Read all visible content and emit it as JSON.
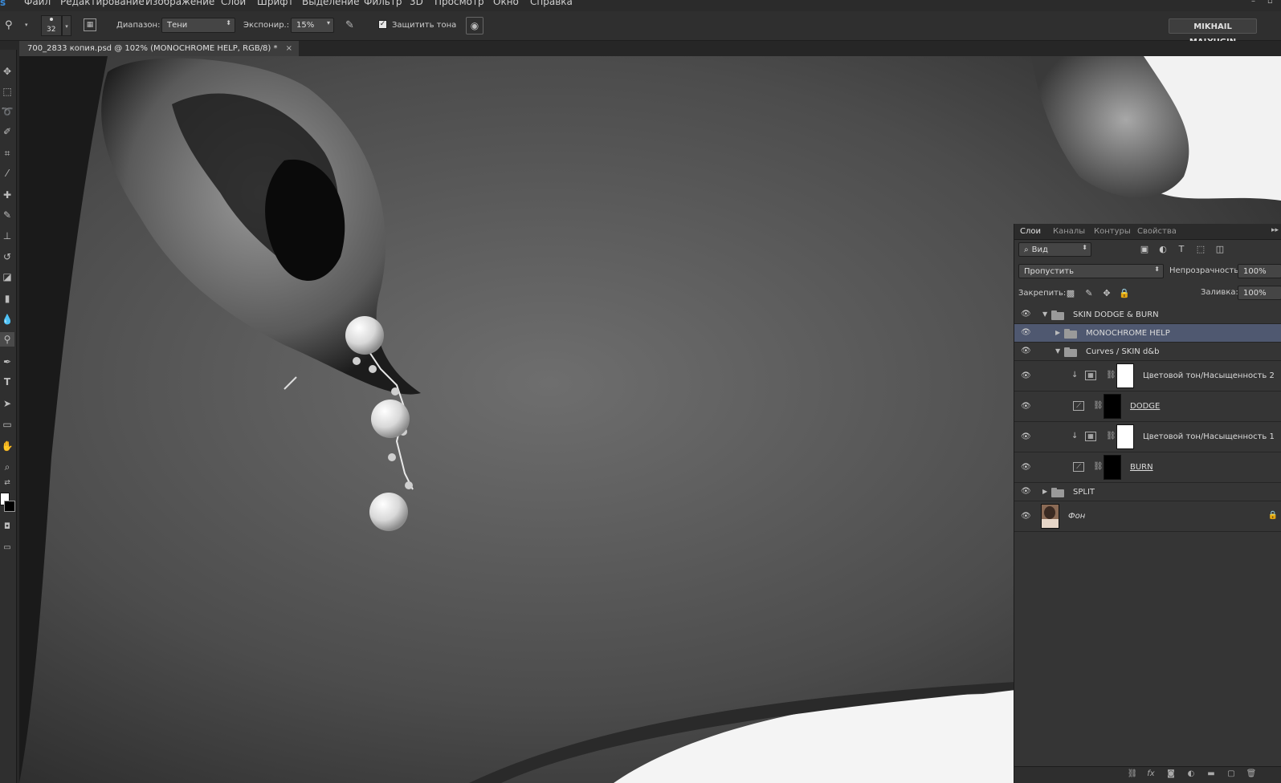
{
  "menu": {
    "logo": "s",
    "items": [
      "Файл",
      "Редактирование",
      "Изображение",
      "Слои",
      "Шрифт",
      "Выделение",
      "Фильтр",
      "3D",
      "Просмотр",
      "Окно",
      "Справка"
    ]
  },
  "options": {
    "brush_size": "32",
    "range_label": "Диапазон:",
    "range_value": "Тени",
    "exposure_label": "Экспонир.:",
    "exposure_value": "15%",
    "protect_label": "Защитить тона",
    "protect_checked": true,
    "user": "MIKHAIL MALYUGIN"
  },
  "document_tab": {
    "title": "700_2833 копия.psd @ 102% (MONOCHROME HELP, RGB/8) *",
    "close": "×"
  },
  "layers_panel": {
    "tabs": [
      "Слои",
      "Каналы",
      "Контуры",
      "Свойства"
    ],
    "active_tab": "Слои",
    "filter_value": "Вид",
    "blend_mode": "Пропустить",
    "opacity_label": "Непрозрачность:",
    "opacity_value": "100%",
    "lock_label": "Закрепить:",
    "fill_label": "Заливка:",
    "fill_value": "100%",
    "layers": [
      {
        "name": "SKIN DODGE & BURN",
        "type": "group",
        "expanded": true
      },
      {
        "name": "MONOCHROME HELP",
        "type": "group",
        "expanded": false,
        "selected": true
      },
      {
        "name": "Curves  / SKIN d&b",
        "type": "group",
        "expanded": true
      },
      {
        "name": "Цветовой тон/Насыщенность 2",
        "type": "adjustment",
        "mask": "white",
        "clipped": true
      },
      {
        "name": "DODGE",
        "type": "curves",
        "mask": "black"
      },
      {
        "name": "Цветовой тон/Насыщенность 1",
        "type": "adjustment",
        "mask": "white",
        "clipped": true
      },
      {
        "name": "BURN",
        "type": "curves",
        "mask": "black"
      },
      {
        "name": "SPLIT",
        "type": "group",
        "expanded": false
      },
      {
        "name": "Фон",
        "type": "background",
        "locked": true
      }
    ]
  },
  "colors": {
    "selected_layer": "#4f5870",
    "panel_bg": "#353535",
    "accent_blue": "#3a8bd9"
  }
}
